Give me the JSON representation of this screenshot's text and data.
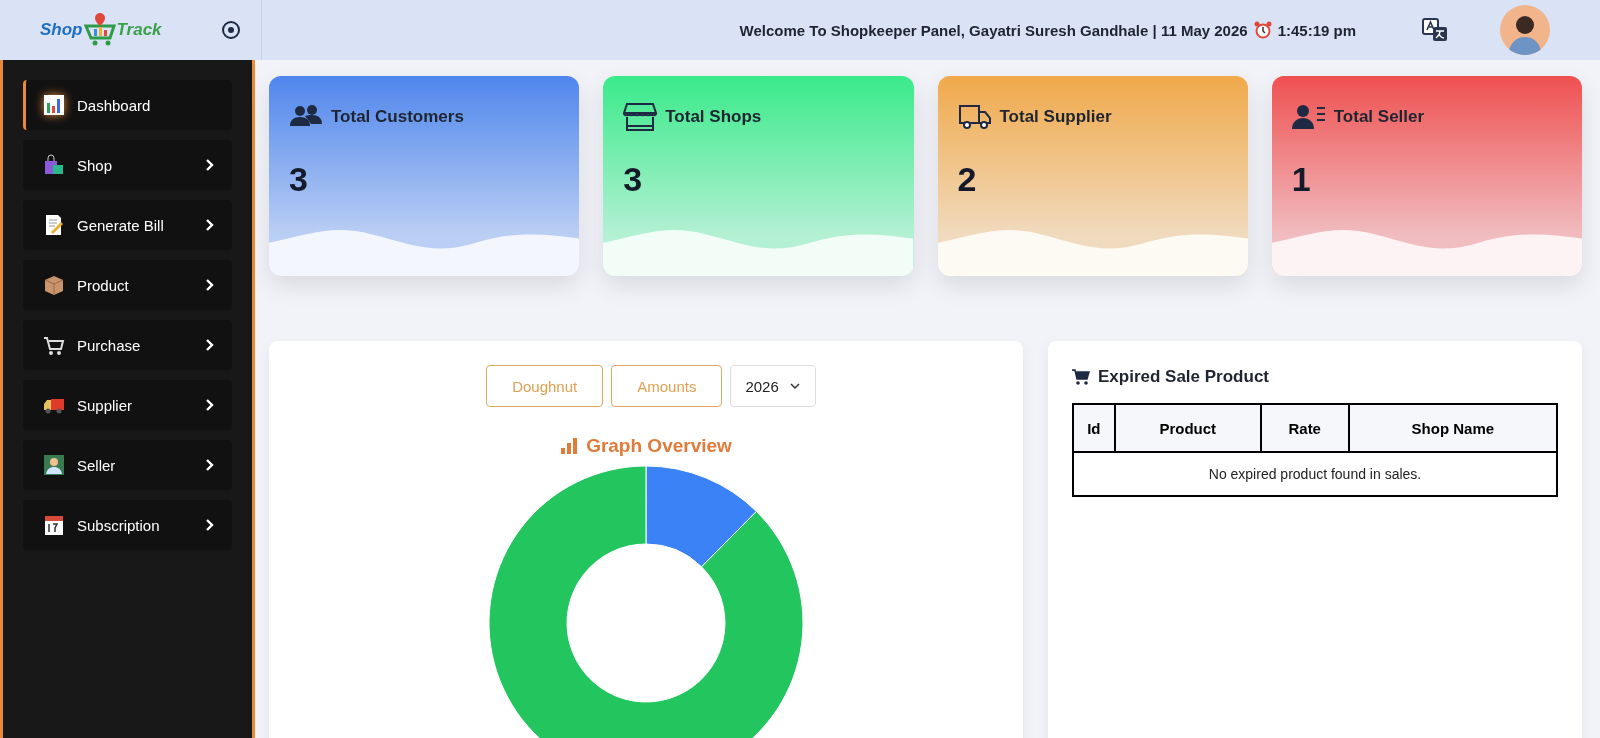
{
  "header": {
    "logo": {
      "part_1": "Shop",
      "part_2": "Track"
    },
    "welcome": "Welcome To Shopkeeper Panel, Gayatri Suresh Gandhale | 11 May 2026",
    "time": "1:45:19 pm"
  },
  "sidebar": {
    "items": [
      {
        "label": "Dashboard",
        "selected": true,
        "expandable": false
      },
      {
        "label": "Shop",
        "selected": false,
        "expandable": true
      },
      {
        "label": "Generate Bill",
        "selected": false,
        "expandable": true
      },
      {
        "label": "Product",
        "selected": false,
        "expandable": true
      },
      {
        "label": "Purchase",
        "selected": false,
        "expandable": true
      },
      {
        "label": "Supplier",
        "selected": false,
        "expandable": true
      },
      {
        "label": "Seller",
        "selected": false,
        "expandable": true
      },
      {
        "label": "Subscription",
        "selected": false,
        "expandable": true
      }
    ]
  },
  "cards": [
    {
      "title": "Total Customers",
      "value": "3",
      "color": "#4f86ec"
    },
    {
      "title": "Total Shops",
      "value": "3",
      "color": "#3aea8a"
    },
    {
      "title": "Total Supplier",
      "value": "2",
      "color": "#f0a94a"
    },
    {
      "title": "Total Seller",
      "value": "1",
      "color": "#ef5050"
    }
  ],
  "chart_panel": {
    "buttons": [
      "Doughnut",
      "Amounts"
    ],
    "year": "2026",
    "title": "Graph Overview"
  },
  "expired_panel": {
    "title": "Expired Sale Product",
    "columns": [
      "Id",
      "Product",
      "Rate",
      "Shop Name"
    ],
    "empty_message": "No expired product found in sales."
  }
}
